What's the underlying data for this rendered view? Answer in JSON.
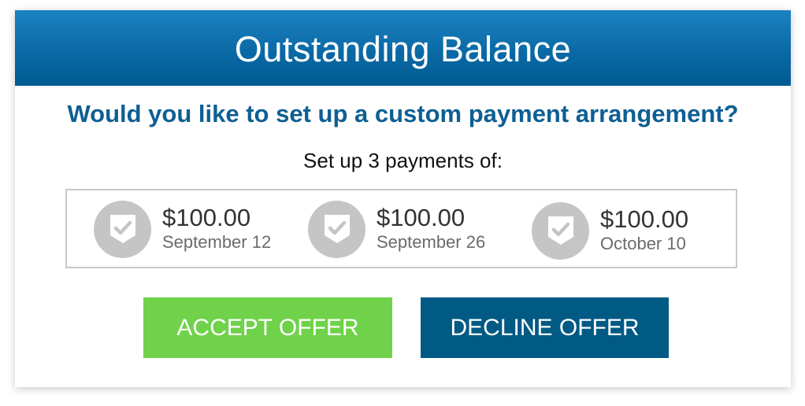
{
  "dialog": {
    "title": "Outstanding Balance",
    "question": "Would you like to set up a custom payment arrangement?",
    "subtext": "Set up 3 payments of:"
  },
  "payments": [
    {
      "amount": "$100.00",
      "date": "September 12",
      "icon": "shield-check-icon"
    },
    {
      "amount": "$100.00",
      "date": "September 26",
      "icon": "shield-check-icon"
    },
    {
      "amount": "$100.00",
      "date": "October 10",
      "icon": "shield-check-icon"
    }
  ],
  "buttons": {
    "accept_label": "ACCEPT OFFER",
    "decline_label": "DECLINE OFFER"
  },
  "colors": {
    "header": "#0a6aa6",
    "question": "#0e5f93",
    "accept": "#6fd24a",
    "decline": "#005a84",
    "badge": "#c5c5c5"
  }
}
